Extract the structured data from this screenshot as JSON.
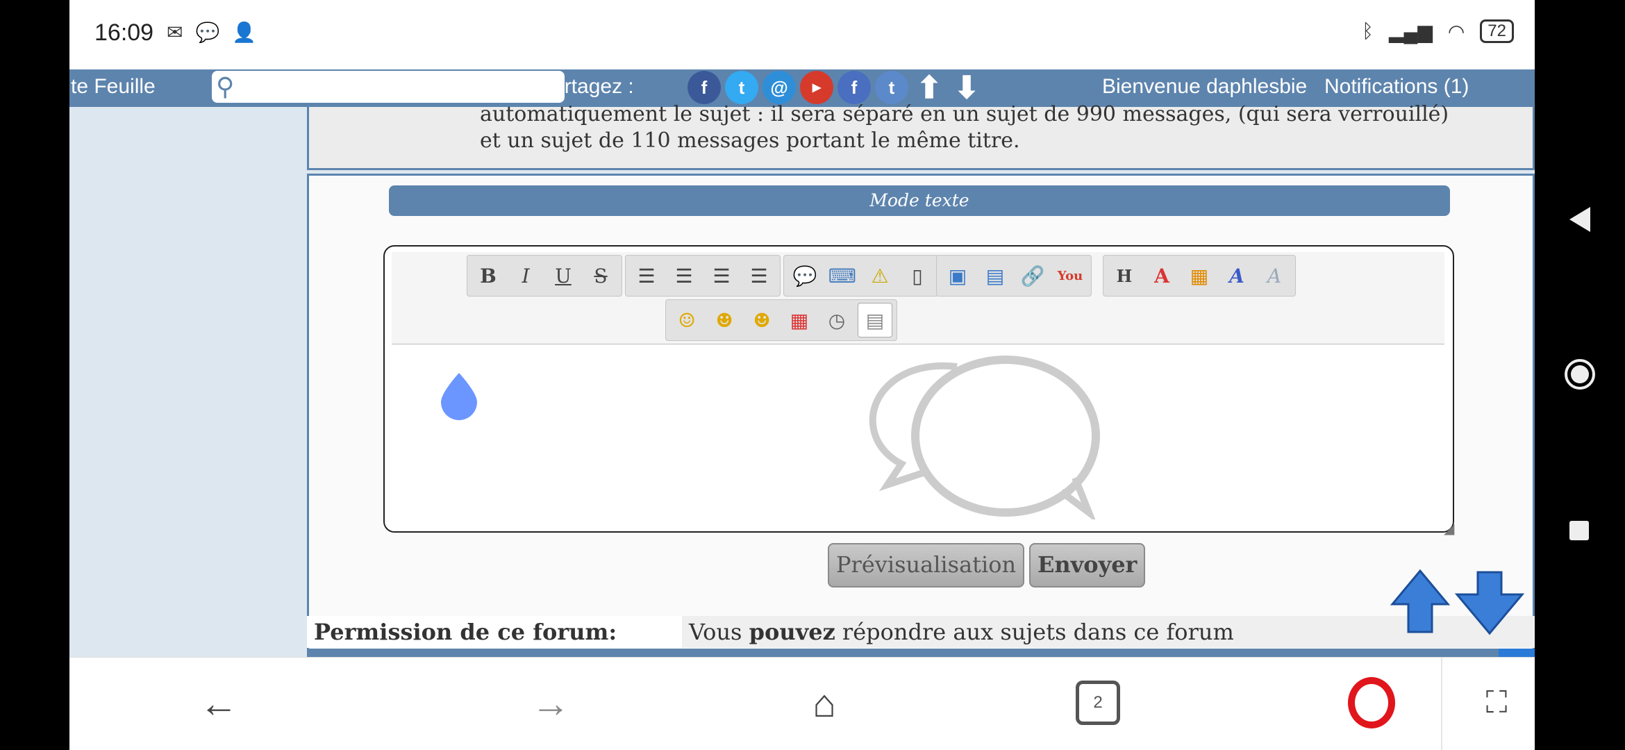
{
  "status_bar": {
    "time": "16:09",
    "battery": "72"
  },
  "header": {
    "site_title": "te Feuille",
    "search_placeholder": "",
    "share_label": "Partagez :",
    "share_icons": [
      "facebook-icon",
      "twitter-icon",
      "email-icon",
      "youtube-icon",
      "facebook-icon",
      "twitter-icon",
      "arrow-up-icon",
      "arrow-down-icon"
    ],
    "welcome": "Bienvenue daphlesbie",
    "notifications": "Notifications  (1)",
    "bar_color": "#5d84ad"
  },
  "rules_text": "automatiquement le sujet : il sera séparé en un sujet de 990 messages, (qui sera verrouillé) et un sujet de 110 messages portant le même titre.",
  "editor": {
    "mode_label": "Mode texte",
    "toolbar_row1": [
      [
        "bold-icon",
        "italic-icon",
        "underline-icon",
        "strikethrough-icon"
      ],
      [
        "align-left-icon",
        "align-center-icon",
        "align-right-icon",
        "justify-icon"
      ],
      [
        "quote-icon",
        "code-icon",
        "spoiler-icon",
        "hide-icon"
      ],
      [
        "image-host-icon",
        "image-icon",
        "link-icon",
        "youtube-icon"
      ],
      [
        "heading-icon",
        "font-size-icon",
        "color-icon",
        "font-icon",
        "remove-format-icon"
      ]
    ],
    "toolbar_row2": [
      "smiley-icon",
      "grin-icon",
      "laugh-icon",
      "calendar-icon",
      "clock-icon",
      "source-icon"
    ]
  },
  "buttons": {
    "preview": "Prévisualisation",
    "send": "Envoyer"
  },
  "permission": {
    "label": "Permission de ce forum:",
    "value_prefix": "Vous ",
    "value_bold": "pouvez",
    "value_suffix": " répondre aux sujets dans ce forum"
  },
  "browser_bar": {
    "tabs_count": "2"
  }
}
